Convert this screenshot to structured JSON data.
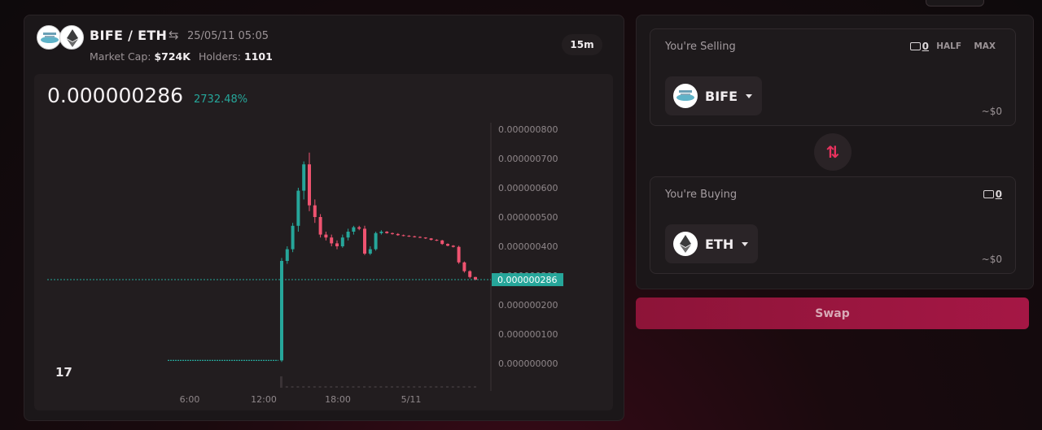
{
  "header": {
    "pair_name": "BIFE / ETH",
    "swap_symbol": "⇆",
    "date": "25/05/11 05:05",
    "market_cap_label": "Market Cap:",
    "market_cap": "$724K",
    "holders_label": "Holders:",
    "holders": "1101",
    "timeframe": "15m"
  },
  "price": {
    "current": "0.000000286",
    "change": "2732.48%",
    "tag": "0.000000286"
  },
  "chart_data": {
    "type": "candlestick",
    "x_ticks": [
      "6:00",
      "12:00",
      "18:00",
      "5/11"
    ],
    "y_ticks": [
      "0.000000000",
      "0.000000100",
      "0.000000200",
      "0.000000300",
      "0.000000400",
      "0.000000500",
      "0.000000600",
      "0.000000700",
      "0.000000800"
    ],
    "ylim": [
      0,
      8e-07
    ],
    "current_price": 2.86e-07,
    "colors": {
      "up": "#26a69a",
      "down": "#ef5370"
    },
    "candles": [
      {
        "o": 1e-08,
        "h": 1e-08,
        "l": 1e-08,
        "c": 1e-08
      },
      {
        "o": 1e-08,
        "h": 3.6e-07,
        "l": 5e-09,
        "c": 3.5e-07
      },
      {
        "o": 3.5e-07,
        "h": 4e-07,
        "l": 3.4e-07,
        "c": 3.9e-07
      },
      {
        "o": 3.9e-07,
        "h": 4.8e-07,
        "l": 3.8e-07,
        "c": 4.7e-07
      },
      {
        "o": 4.7e-07,
        "h": 6e-07,
        "l": 4.5e-07,
        "c": 5.9e-07
      },
      {
        "o": 5.9e-07,
        "h": 6.9e-07,
        "l": 5.6e-07,
        "c": 6.8e-07
      },
      {
        "o": 6.8e-07,
        "h": 7.2e-07,
        "l": 5.2e-07,
        "c": 5.4e-07
      },
      {
        "o": 5.4e-07,
        "h": 5.6e-07,
        "l": 4.8e-07,
        "c": 5e-07
      },
      {
        "o": 5e-07,
        "h": 5.1e-07,
        "l": 4.3e-07,
        "c": 4.4e-07
      },
      {
        "o": 4.4e-07,
        "h": 4.5e-07,
        "l": 4.2e-07,
        "c": 4.3e-07
      },
      {
        "o": 4.3e-07,
        "h": 4.4e-07,
        "l": 4e-07,
        "c": 4.1e-07
      },
      {
        "o": 4.1e-07,
        "h": 4.2e-07,
        "l": 3.9e-07,
        "c": 4e-07
      },
      {
        "o": 4e-07,
        "h": 4.4e-07,
        "l": 3.95e-07,
        "c": 4.3e-07
      },
      {
        "o": 4.3e-07,
        "h": 4.6e-07,
        "l": 4.2e-07,
        "c": 4.5e-07
      },
      {
        "o": 4.5e-07,
        "h": 4.7e-07,
        "l": 4.4e-07,
        "c": 4.65e-07
      },
      {
        "o": 4.65e-07,
        "h": 4.7e-07,
        "l": 4.55e-07,
        "c": 4.6e-07
      },
      {
        "o": 4.6e-07,
        "h": 4.7e-07,
        "l": 3.7e-07,
        "c": 3.75e-07
      },
      {
        "o": 3.75e-07,
        "h": 4e-07,
        "l": 3.7e-07,
        "c": 3.9e-07
      },
      {
        "o": 3.9e-07,
        "h": 4.5e-07,
        "l": 3.85e-07,
        "c": 4.45e-07
      },
      {
        "o": 4.45e-07,
        "h": 4.55e-07,
        "l": 4.4e-07,
        "c": 4.5e-07
      },
      {
        "o": 4.5e-07,
        "h": 4.52e-07,
        "l": 4.43e-07,
        "c": 4.45e-07
      },
      {
        "o": 4.45e-07,
        "h": 4.47e-07,
        "l": 4.4e-07,
        "c": 4.42e-07
      },
      {
        "o": 4.42e-07,
        "h": 4.45e-07,
        "l": 4.36e-07,
        "c": 4.38e-07
      },
      {
        "o": 4.38e-07,
        "h": 4.4e-07,
        "l": 4.34e-07,
        "c": 4.36e-07
      },
      {
        "o": 4.36e-07,
        "h": 4.38e-07,
        "l": 4.32e-07,
        "c": 4.34e-07
      },
      {
        "o": 4.34e-07,
        "h": 4.36e-07,
        "l": 4.3e-07,
        "c": 4.32e-07
      },
      {
        "o": 4.32e-07,
        "h": 4.34e-07,
        "l": 4.28e-07,
        "c": 4.3e-07
      },
      {
        "o": 4.3e-07,
        "h": 4.31e-07,
        "l": 4.25e-07,
        "c": 4.27e-07
      },
      {
        "o": 4.27e-07,
        "h": 4.28e-07,
        "l": 4.2e-07,
        "c": 4.22e-07
      },
      {
        "o": 4.22e-07,
        "h": 4.24e-07,
        "l": 4.18e-07,
        "c": 4.2e-07
      },
      {
        "o": 4.2e-07,
        "h": 4.22e-07,
        "l": 4.05e-07,
        "c": 4.08e-07
      },
      {
        "o": 4.08e-07,
        "h": 4.1e-07,
        "l": 4e-07,
        "c": 4.02e-07
      },
      {
        "o": 4.02e-07,
        "h": 4.04e-07,
        "l": 3.96e-07,
        "c": 3.98e-07
      },
      {
        "o": 3.98e-07,
        "h": 4.02e-07,
        "l": 3.4e-07,
        "c": 3.45e-07
      },
      {
        "o": 3.45e-07,
        "h": 3.48e-07,
        "l": 3.1e-07,
        "c": 3.15e-07
      },
      {
        "o": 3.15e-07,
        "h": 3.18e-07,
        "l": 2.9e-07,
        "c": 2.95e-07
      },
      {
        "o": 2.95e-07,
        "h": 2.96e-07,
        "l": 2.84e-07,
        "c": 2.86e-07
      }
    ]
  },
  "selling": {
    "label": "You're Selling",
    "wallet_balance": "0",
    "half_label": "HALF",
    "max_label": "MAX",
    "token": "BIFE",
    "usd_value": "~$0"
  },
  "buying": {
    "label": "You're Buying",
    "wallet_balance": "0",
    "token": "ETH",
    "usd_value": "~$0"
  },
  "flip_symbol": "⇅",
  "swap_label": "Swap",
  "tv_logo": "17"
}
